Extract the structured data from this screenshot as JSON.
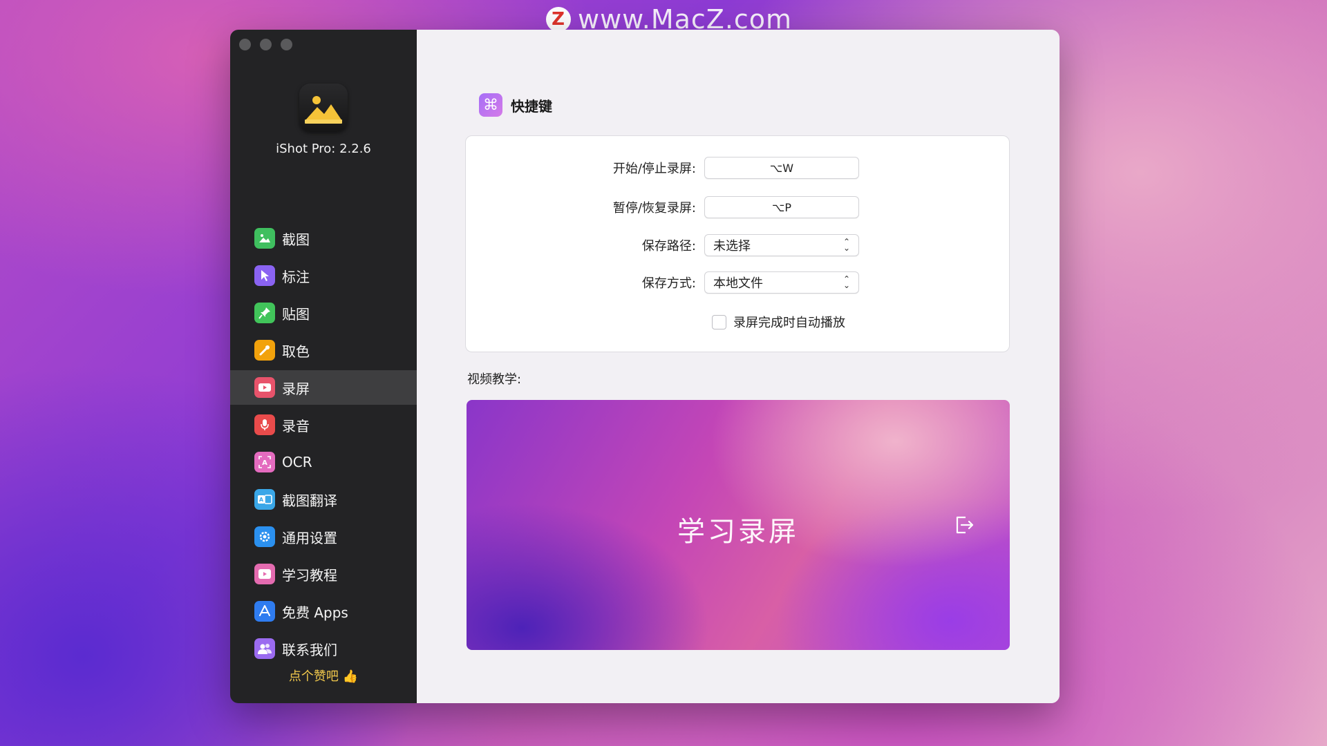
{
  "watermark": {
    "logo_letter": "Z",
    "text": "www.MacZ.com"
  },
  "app": {
    "title": "iShot Pro: 2.2.6"
  },
  "sidebar": {
    "items": [
      {
        "label": "截图",
        "icon": "landscape-icon",
        "color": "#3fbf5f",
        "active": false
      },
      {
        "label": "标注",
        "icon": "pointer-icon",
        "color": "#8a63f2",
        "active": false
      },
      {
        "label": "贴图",
        "icon": "pin-icon",
        "color": "#41c45a",
        "active": false
      },
      {
        "label": "取色",
        "icon": "eyedropper-icon",
        "color": "#f2a20c",
        "active": false
      },
      {
        "label": "录屏",
        "icon": "video-record-icon",
        "color": "#e8536b",
        "active": true
      },
      {
        "label": "录音",
        "icon": "microphone-icon",
        "color": "#e94b4b",
        "active": false
      },
      {
        "label": "OCR",
        "icon": "ocr-icon",
        "color": "#e46bbf",
        "active": false
      },
      {
        "label": "截图翻译",
        "icon": "translate-icon",
        "color": "#3aa7e8",
        "active": false
      },
      {
        "label": "通用设置",
        "icon": "gear-icon",
        "color": "#2b90ef",
        "active": false
      },
      {
        "label": "学习教程",
        "icon": "tutorial-icon",
        "color": "#e46bb0",
        "active": false
      },
      {
        "label": "免费 Apps",
        "icon": "appstore-icon",
        "color": "#2f7cf0",
        "active": false
      },
      {
        "label": "联系我们",
        "icon": "contacts-icon",
        "color": "#9b6bf0",
        "active": false
      }
    ],
    "like_label": "点个赞吧 👍"
  },
  "main": {
    "section_title": "快捷键",
    "fields": {
      "start_stop_label": "开始/停止录屏:",
      "start_stop_value": "⌥W",
      "pause_resume_label": "暂停/恢复录屏:",
      "pause_resume_value": "⌥P",
      "save_path_label": "保存路径:",
      "save_path_value": "未选择",
      "save_mode_label": "保存方式:",
      "save_mode_value": "本地文件",
      "autoplay_label": "录屏完成时自动播放",
      "autoplay_checked": false
    },
    "video_label": "视频教学:",
    "video_title": "学习录屏"
  }
}
